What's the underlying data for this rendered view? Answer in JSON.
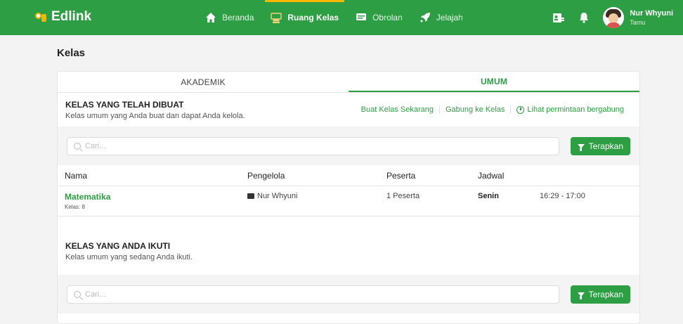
{
  "app": {
    "name": "Edlink"
  },
  "nav": {
    "items": [
      {
        "label": "Beranda",
        "icon": "home-icon",
        "active": false
      },
      {
        "label": "Ruang Kelas",
        "icon": "classroom-icon",
        "active": true
      },
      {
        "label": "Obrolan",
        "icon": "chat-icon",
        "active": false
      },
      {
        "label": "Jelajah",
        "icon": "rocket-icon",
        "active": false
      }
    ]
  },
  "user": {
    "name": "Nur Whyuni",
    "role": "Tamu"
  },
  "page": {
    "title": "Kelas"
  },
  "tabs": [
    {
      "label": "AKADEMIK",
      "active": false
    },
    {
      "label": "UMUM",
      "active": true
    }
  ],
  "created": {
    "title": "KELAS YANG TELAH DIBUAT",
    "subtitle": "Kelas umum yang Anda buat dan dapat Anda kelola.",
    "actions": {
      "create": "Buat Kelas Sekarang",
      "join": "Gabung ke Kelas",
      "requests": "Lihat permintaan bergabung"
    },
    "search_placeholder": "Cari...",
    "apply_label": "Terapkan",
    "columns": {
      "name": "Nama",
      "manager": "Pengelola",
      "participants": "Peserta",
      "schedule": "Jadwal"
    },
    "rows": [
      {
        "name": "Matematika",
        "grade": "Kelas: 8",
        "manager": "Nur Whyuni",
        "participants": "1 Peserta",
        "day": "Senin",
        "time": "16:29 - 17:00"
      }
    ]
  },
  "joined": {
    "title": "KELAS YANG ANDA IKUTI",
    "subtitle": "Kelas umum yang sedang Anda ikuti.",
    "search_placeholder": "Cari...",
    "apply_label": "Terapkan"
  },
  "colors": {
    "primary": "#2e9e44",
    "accent": "#f7b500"
  }
}
